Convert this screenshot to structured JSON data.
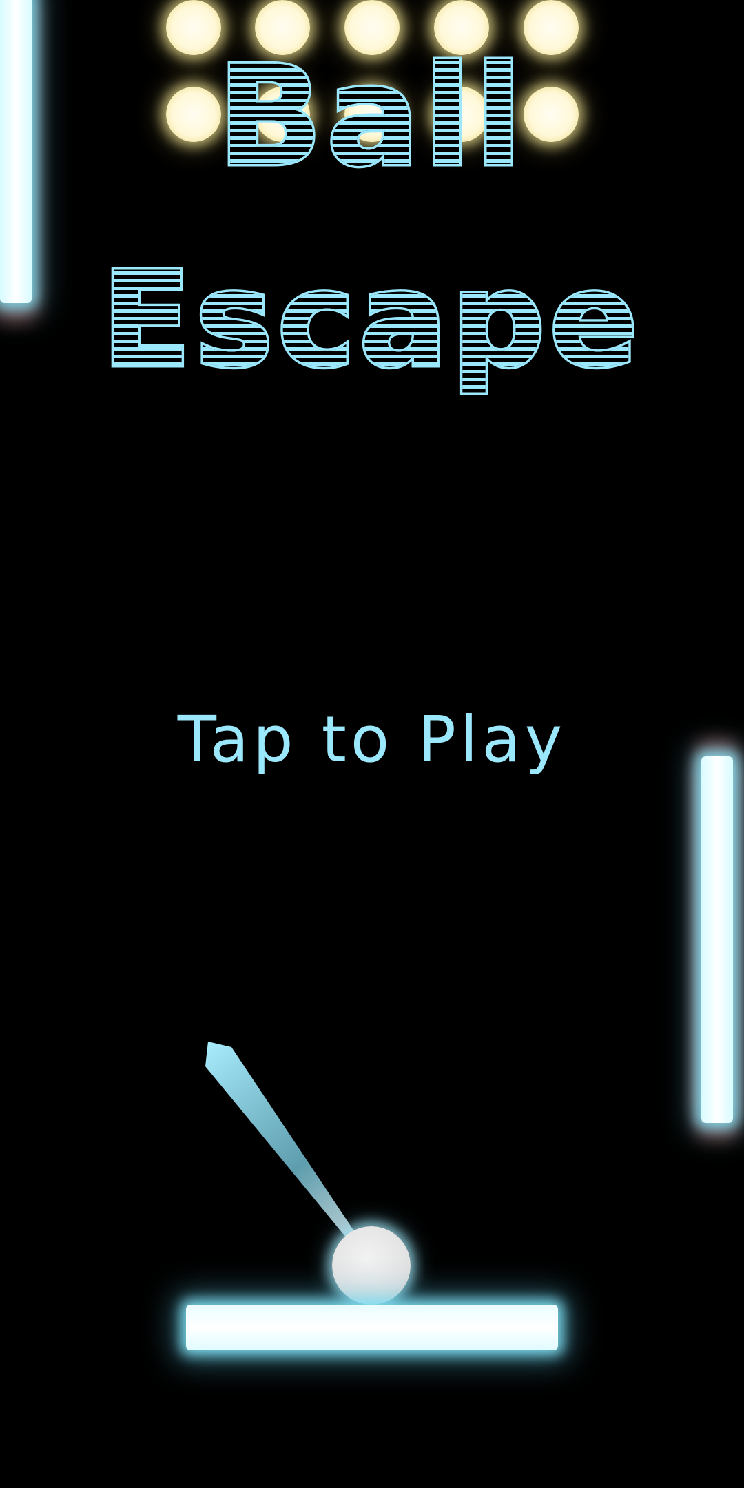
{
  "game": {
    "title_line1": "Ball",
    "title_line2": "Escape",
    "prompt": "Tap to Play"
  },
  "colors": {
    "background": "#000000",
    "title": "#9be7fb",
    "prompt": "#9be7fb",
    "orb": "#fff8d8",
    "orb_glow": "#eee296",
    "bar_glow": "#82e1f5",
    "bar_edge_glow": "#ff8278",
    "ball": "#e3e3e3",
    "aim_arrow": "#9be7fb"
  },
  "icons": {
    "aim": "aim-arrow-icon",
    "ball": "ball-icon",
    "paddle": "paddle-icon",
    "target": "orb-target-icon"
  }
}
